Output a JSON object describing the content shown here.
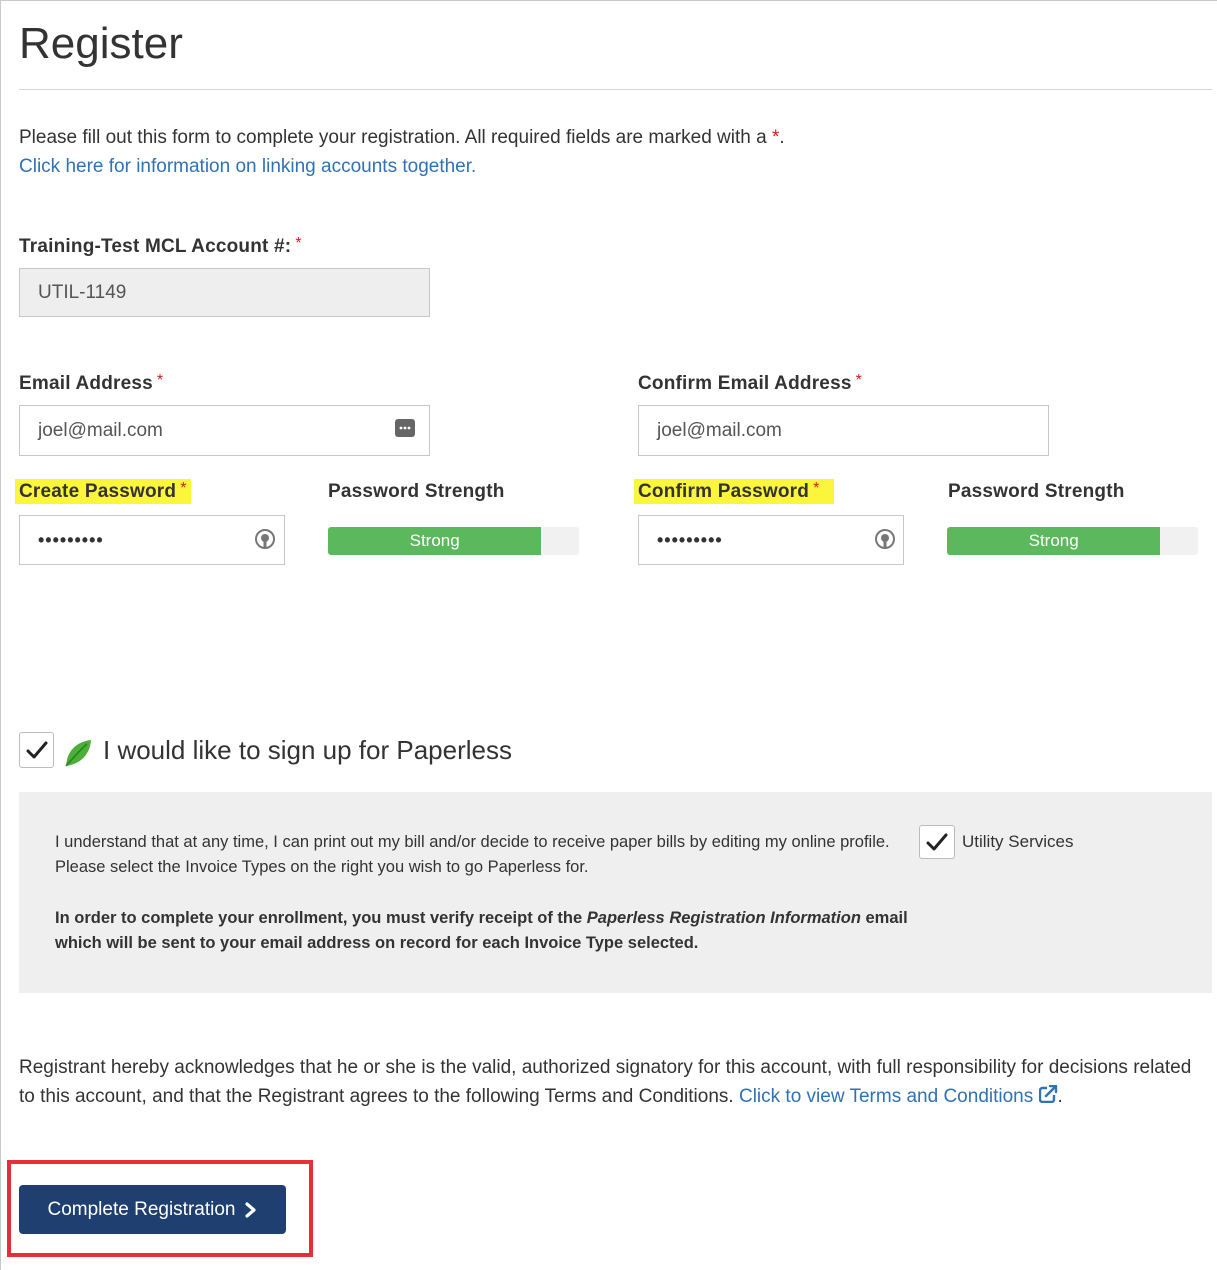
{
  "page": {
    "title": "Register",
    "intro_text": "Please fill out this form to complete your registration. All required fields are marked with a ",
    "required_marker": "*",
    "intro_period": ".",
    "linking_link": "Click here for information on linking accounts together."
  },
  "account": {
    "label": "Training-Test MCL Account #:",
    "value": "UTIL-1149"
  },
  "email": {
    "label": "Email Address",
    "value": "joel@mail.com",
    "confirm_label": "Confirm Email Address",
    "confirm_value": "joel@mail.com"
  },
  "password": {
    "create_label": "Create Password",
    "create_value": "•••••••••",
    "confirm_label": "Confirm Password",
    "confirm_value": "•••••••••",
    "strength_label": "Password Strength",
    "strength_text": "Strong",
    "strength_level": 0.85
  },
  "paperless": {
    "checked": true,
    "label": "I would like to sign up for Paperless",
    "info_text": "I understand that at any time, I can print out my bill and/or decide to receive paper bills by editing my online profile. Please select the Invoice Types on the right you wish to go Paperless for.",
    "enroll_prefix": "In order to complete your enrollment, you must verify receipt of the ",
    "enroll_italic": "Paperless Registration Information",
    "enroll_suffix": " email which will be sent to your email address on record for each Invoice Type selected.",
    "service_checked": true,
    "service_label": "Utility Services"
  },
  "terms": {
    "text": "Registrant hereby acknowledges that he or she is the valid, authorized signatory for this account, with full responsibility for decisions related to this account, and that the Registrant agrees to the following Terms and Conditions. ",
    "link": "Click to view Terms and Conditions",
    "period": "."
  },
  "actions": {
    "submit_label": "Complete Registration"
  },
  "colors": {
    "accent": "#1e3f6f",
    "link": "#2f72b5",
    "required": "#cc1f1f",
    "strength": "#5cb85c",
    "highlight": "#fbf53c",
    "callout": "#e5303a"
  },
  "icons": {
    "email_field": "autofill-dots-icon",
    "password_field": "password-reveal-icon",
    "paperless": "leaf-icon",
    "external": "external-link-icon",
    "submit": "chevron-right-icon"
  }
}
